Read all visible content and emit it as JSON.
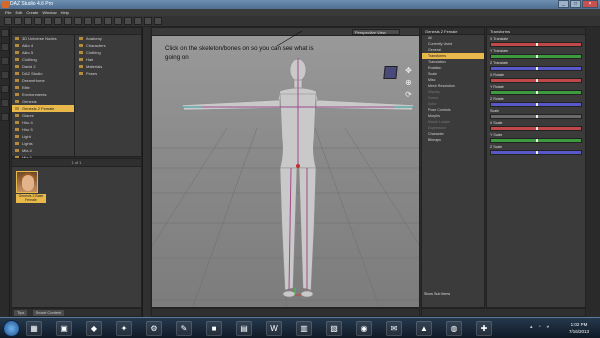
{
  "window": {
    "title": "DAZ Studio 4.6 Pro",
    "buttons": {
      "minimize": "_",
      "maximize": "□",
      "close": "×"
    }
  },
  "menu": [
    "File",
    "Edit",
    "Create",
    "Window",
    "Help"
  ],
  "toolbar_icons": [
    "new-icon",
    "open-icon",
    "save-icon",
    "undo-icon",
    "redo-icon",
    "select-icon",
    "node-icon",
    "universal-tool-icon",
    "rotate-icon",
    "translate-icon",
    "scale-icon",
    "joint-editor-icon",
    "render-icon",
    "preview-icon",
    "camera-icon",
    "light-icon"
  ],
  "content_library": {
    "col1": [
      "3D Universe Nodes",
      "Aiko 4",
      "Aiko 5",
      "Clothing",
      "David 2",
      "DAZ Studio",
      "DreamHome",
      "Elite",
      "Environments",
      "Genesis",
      "Genesis 2 Female",
      "Gianni",
      "Hiro 4",
      "Hiro 5",
      "Light",
      "Lights",
      "Mia 4",
      "Mia 5",
      "Michael 4",
      "Michael 5",
      "Props"
    ],
    "col2": [
      "Anatomy",
      "Characters",
      "Clothing",
      "Hair",
      "Materials",
      "Poses"
    ],
    "col1_selected_index": 10,
    "page_indicator": "1 of 1",
    "thumb_label": "Genesis 2 Base Female",
    "bottom_tabs": [
      "Tips",
      "Smart Content"
    ]
  },
  "viewport": {
    "camera": "Perspective View",
    "note": "Click on the skeleton/bones on so you can see what is going on",
    "nav_controls": [
      "✥",
      "⊕",
      "⟳"
    ]
  },
  "parameters_list": {
    "title": "Genesis 2 Female",
    "items": [
      {
        "label": "All",
        "state": "normal"
      },
      {
        "label": "Currently Used",
        "state": "normal"
      },
      {
        "label": "General",
        "state": "normal"
      },
      {
        "label": "Transforms",
        "state": "selected"
      },
      {
        "label": "Translation",
        "state": "normal"
      },
      {
        "label": "Rotation",
        "state": "normal"
      },
      {
        "label": "Scale",
        "state": "normal"
      },
      {
        "label": "Misc",
        "state": "normal"
      },
      {
        "label": "Mesh Resolution",
        "state": "normal"
      },
      {
        "label": "Display",
        "state": "dim"
      },
      {
        "label": "Scene",
        "state": "dim"
      },
      {
        "label": "Actor",
        "state": "dim"
      },
      {
        "label": "Pose Controls",
        "state": "normal"
      },
      {
        "label": "Morphs",
        "state": "normal"
      },
      {
        "label": "Morph Loader",
        "state": "dim"
      },
      {
        "label": "Expression",
        "state": "dim"
      },
      {
        "label": "Character",
        "state": "normal"
      },
      {
        "label": "Bitmaps",
        "state": "normal"
      }
    ],
    "show_sub_items": "Show Sub Items"
  },
  "sliders": {
    "header": "Transforms",
    "groups": [
      {
        "label": "X Translate",
        "color": "red",
        "value": 0.5
      },
      {
        "label": "Y Translate",
        "color": "green",
        "value": 0.5
      },
      {
        "label": "Z Translate",
        "color": "blue",
        "value": 0.5
      },
      {
        "label": "X Rotate",
        "color": "red",
        "value": 0.5
      },
      {
        "label": "Y Rotate",
        "color": "green",
        "value": 0.5
      },
      {
        "label": "Z Rotate",
        "color": "blue",
        "value": 0.5
      },
      {
        "label": "Scale",
        "color": "gray",
        "value": 0.5
      },
      {
        "label": "X Scale",
        "color": "red",
        "value": 0.5
      },
      {
        "label": "Y Scale",
        "color": "green",
        "value": 0.5
      },
      {
        "label": "Z Scale",
        "color": "blue",
        "value": 0.5
      }
    ]
  },
  "taskbar": {
    "apps": [
      "folder-icon",
      "media-icon",
      "daz-icon",
      "fire-icon",
      "explorer-icon",
      "paint-icon",
      "terminal-icon",
      "app-icon",
      "word-icon",
      "notepad-icon",
      "pdf-icon",
      "chrome-icon",
      "mail-icon",
      "vlc-icon",
      "firefox-icon",
      "tool-icon"
    ],
    "glyphs": [
      "▦",
      "▣",
      "◆",
      "✦",
      "⚙",
      "✎",
      "■",
      "▤",
      "W",
      "▥",
      "▧",
      "◉",
      "✉",
      "▲",
      "◍",
      "✚"
    ],
    "time": "1:02 PM",
    "date": "7/16/2013"
  },
  "colors": {
    "accent": "#e8b84a",
    "red": "#c04848",
    "green": "#3e9a3e",
    "blue": "#5858c8"
  }
}
